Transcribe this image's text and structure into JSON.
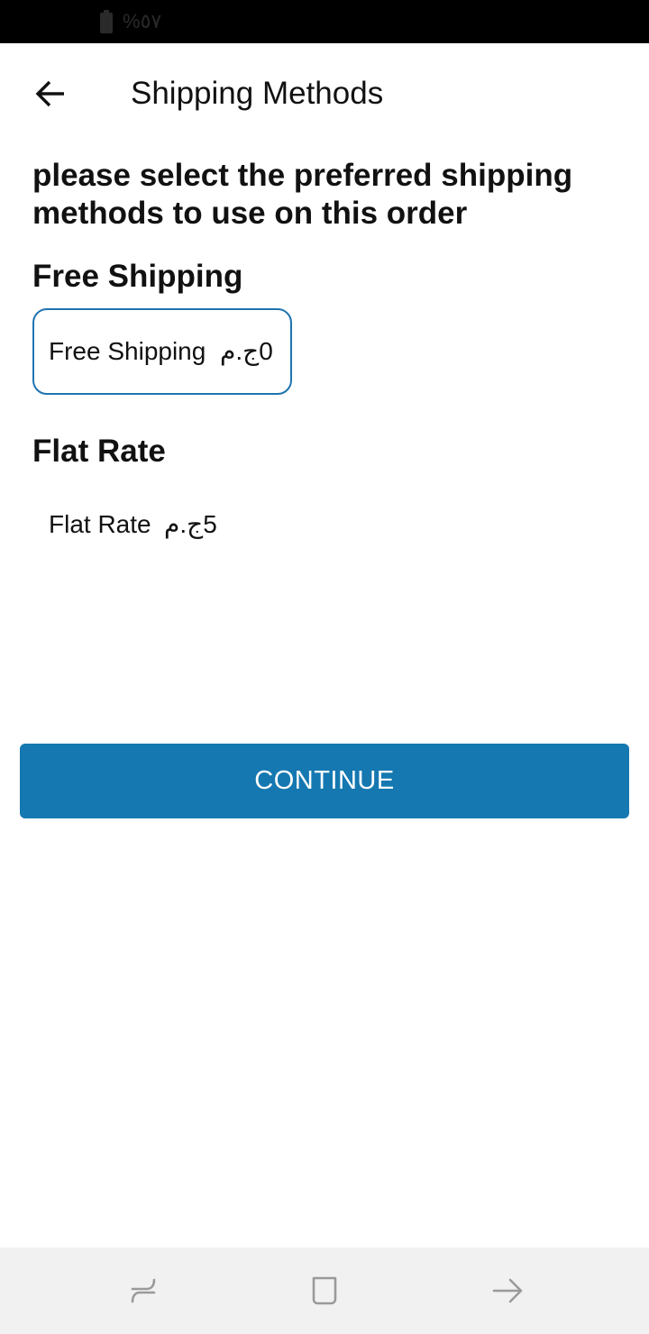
{
  "status_bar": {
    "battery_text": "%٥٧",
    "battery_icon": "battery-icon"
  },
  "header": {
    "back_icon": "arrow-left-icon",
    "title": "Shipping Methods"
  },
  "instructions": "please select the preferred shipping methods to use on this order",
  "sections": [
    {
      "title": "Free Shipping",
      "option": {
        "label": "Free Shipping",
        "price": "0ج.م",
        "selected": true
      }
    },
    {
      "title": "Flat Rate",
      "option": {
        "label": "Flat Rate",
        "price": "5ج.م",
        "selected": false
      }
    }
  ],
  "continue_label": "CONTINUE",
  "nav_bar": {
    "icons": [
      "recent-apps-icon",
      "home-icon",
      "back-icon"
    ]
  },
  "colors": {
    "accent": "#1578b1",
    "selected_border": "#1f74b0",
    "status_bar": "#000000",
    "nav_bar": "#f1f1f1"
  }
}
